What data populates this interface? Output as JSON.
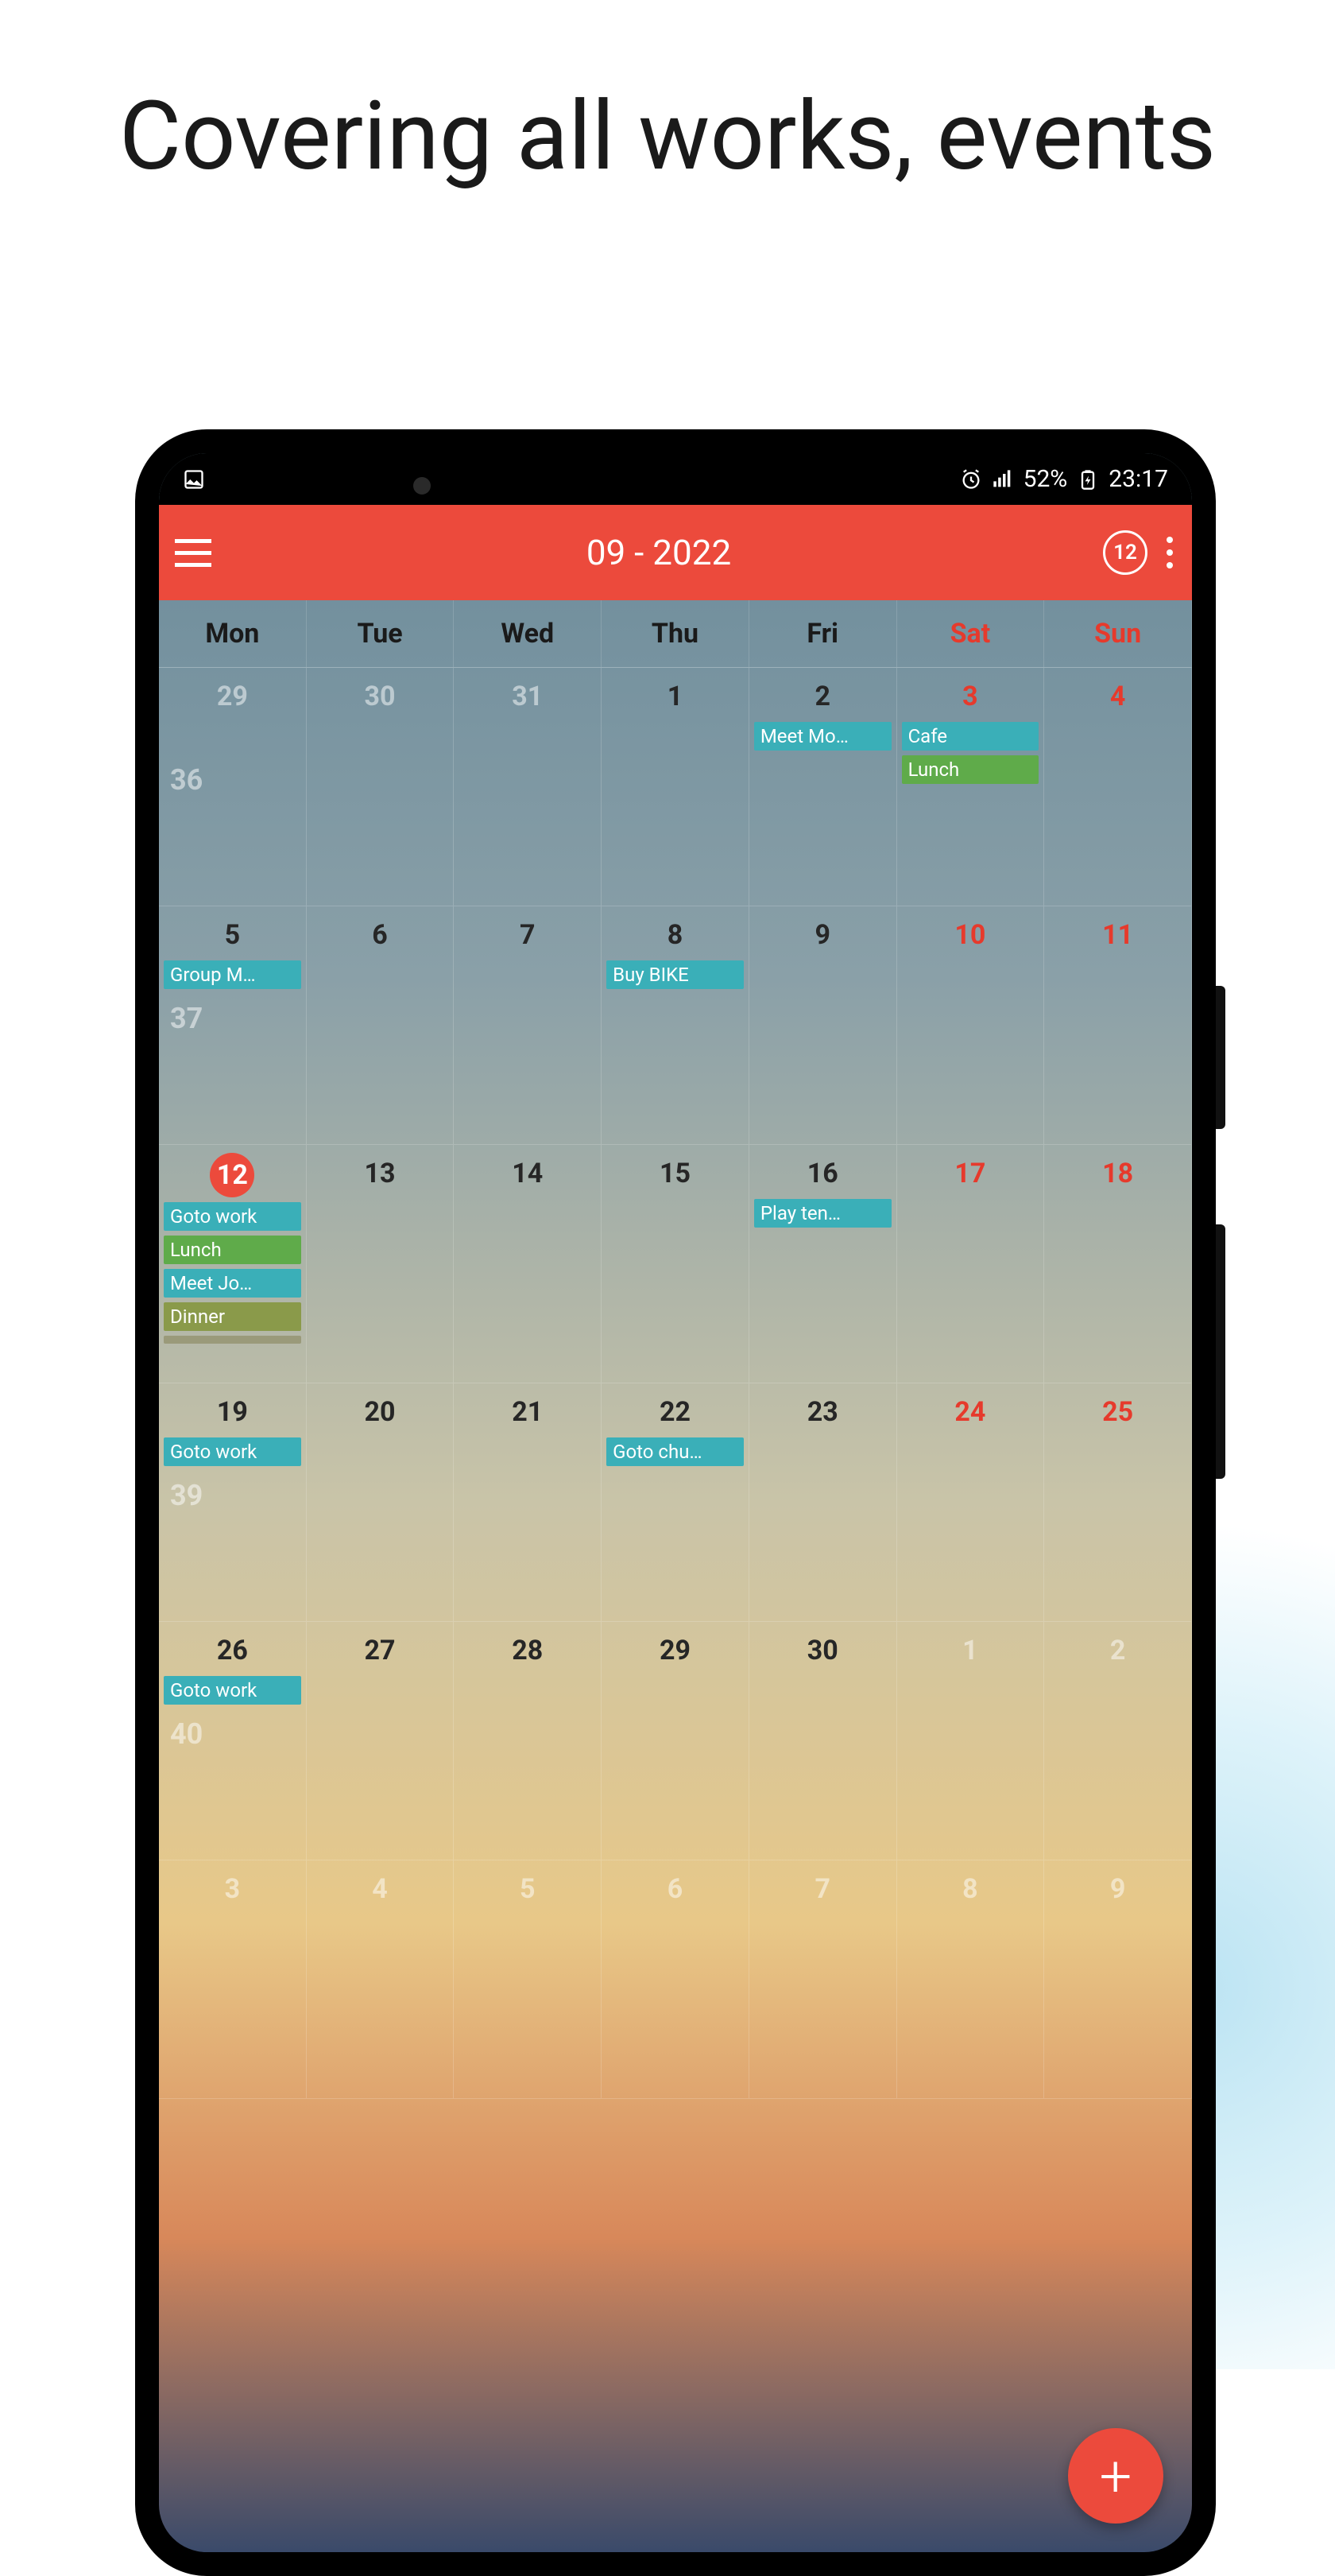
{
  "marketing": {
    "title": "Covering all works, events"
  },
  "status": {
    "battery": "52%",
    "time": "23:17"
  },
  "header": {
    "title": "09 - 2022",
    "today_badge": "12"
  },
  "weekdays": [
    "Mon",
    "Tue",
    "Wed",
    "Thu",
    "Fri",
    "Sat",
    "Sun"
  ],
  "weeks": [
    {
      "num": "36",
      "days": [
        {
          "n": "29",
          "other": true,
          "events": []
        },
        {
          "n": "30",
          "other": true,
          "events": []
        },
        {
          "n": "31",
          "other": true,
          "events": []
        },
        {
          "n": "1",
          "events": []
        },
        {
          "n": "2",
          "events": [
            {
              "label": "Meet Mo…",
              "color": "teal"
            }
          ]
        },
        {
          "n": "3",
          "weekend": true,
          "events": [
            {
              "label": "Cafe",
              "color": "teal"
            },
            {
              "label": "Lunch",
              "color": "green"
            }
          ]
        },
        {
          "n": "4",
          "weekend": true,
          "events": []
        }
      ]
    },
    {
      "num": "37",
      "days": [
        {
          "n": "5",
          "events": [
            {
              "label": "Group M…",
              "color": "teal"
            }
          ]
        },
        {
          "n": "6",
          "events": []
        },
        {
          "n": "7",
          "events": []
        },
        {
          "n": "8",
          "events": [
            {
              "label": "Buy BIKE",
              "color": "teal"
            }
          ]
        },
        {
          "n": "9",
          "events": []
        },
        {
          "n": "10",
          "weekend": true,
          "events": []
        },
        {
          "n": "11",
          "weekend": true,
          "events": []
        }
      ]
    },
    {
      "num": "",
      "days": [
        {
          "n": "12",
          "today": true,
          "events": [
            {
              "label": "Goto work",
              "color": "teal"
            },
            {
              "label": "Lunch",
              "color": "green"
            },
            {
              "label": "Meet Jo…",
              "color": "teal"
            },
            {
              "label": "Dinner",
              "color": "olive"
            }
          ],
          "more": true
        },
        {
          "n": "13",
          "events": []
        },
        {
          "n": "14",
          "events": []
        },
        {
          "n": "15",
          "events": []
        },
        {
          "n": "16",
          "events": [
            {
              "label": "Play ten…",
              "color": "teal"
            }
          ]
        },
        {
          "n": "17",
          "weekend": true,
          "events": []
        },
        {
          "n": "18",
          "weekend": true,
          "events": []
        }
      ]
    },
    {
      "num": "39",
      "days": [
        {
          "n": "19",
          "events": [
            {
              "label": "Goto work",
              "color": "teal"
            }
          ]
        },
        {
          "n": "20",
          "events": []
        },
        {
          "n": "21",
          "events": []
        },
        {
          "n": "22",
          "events": [
            {
              "label": "Goto chu…",
              "color": "teal"
            }
          ]
        },
        {
          "n": "23",
          "events": []
        },
        {
          "n": "24",
          "weekend": true,
          "events": []
        },
        {
          "n": "25",
          "weekend": true,
          "events": []
        }
      ]
    },
    {
      "num": "40",
      "days": [
        {
          "n": "26",
          "events": [
            {
              "label": "Goto work",
              "color": "teal"
            }
          ]
        },
        {
          "n": "27",
          "events": []
        },
        {
          "n": "28",
          "events": []
        },
        {
          "n": "29",
          "events": []
        },
        {
          "n": "30",
          "events": []
        },
        {
          "n": "1",
          "other": true,
          "weekend": true,
          "events": []
        },
        {
          "n": "2",
          "other": true,
          "weekend": true,
          "events": []
        }
      ]
    },
    {
      "num": "",
      "days": [
        {
          "n": "3",
          "other": true,
          "events": []
        },
        {
          "n": "4",
          "other": true,
          "events": []
        },
        {
          "n": "5",
          "other": true,
          "events": []
        },
        {
          "n": "6",
          "other": true,
          "events": []
        },
        {
          "n": "7",
          "other": true,
          "events": []
        },
        {
          "n": "8",
          "other": true,
          "weekend": true,
          "events": []
        },
        {
          "n": "9",
          "other": true,
          "weekend": true,
          "events": []
        }
      ]
    }
  ]
}
